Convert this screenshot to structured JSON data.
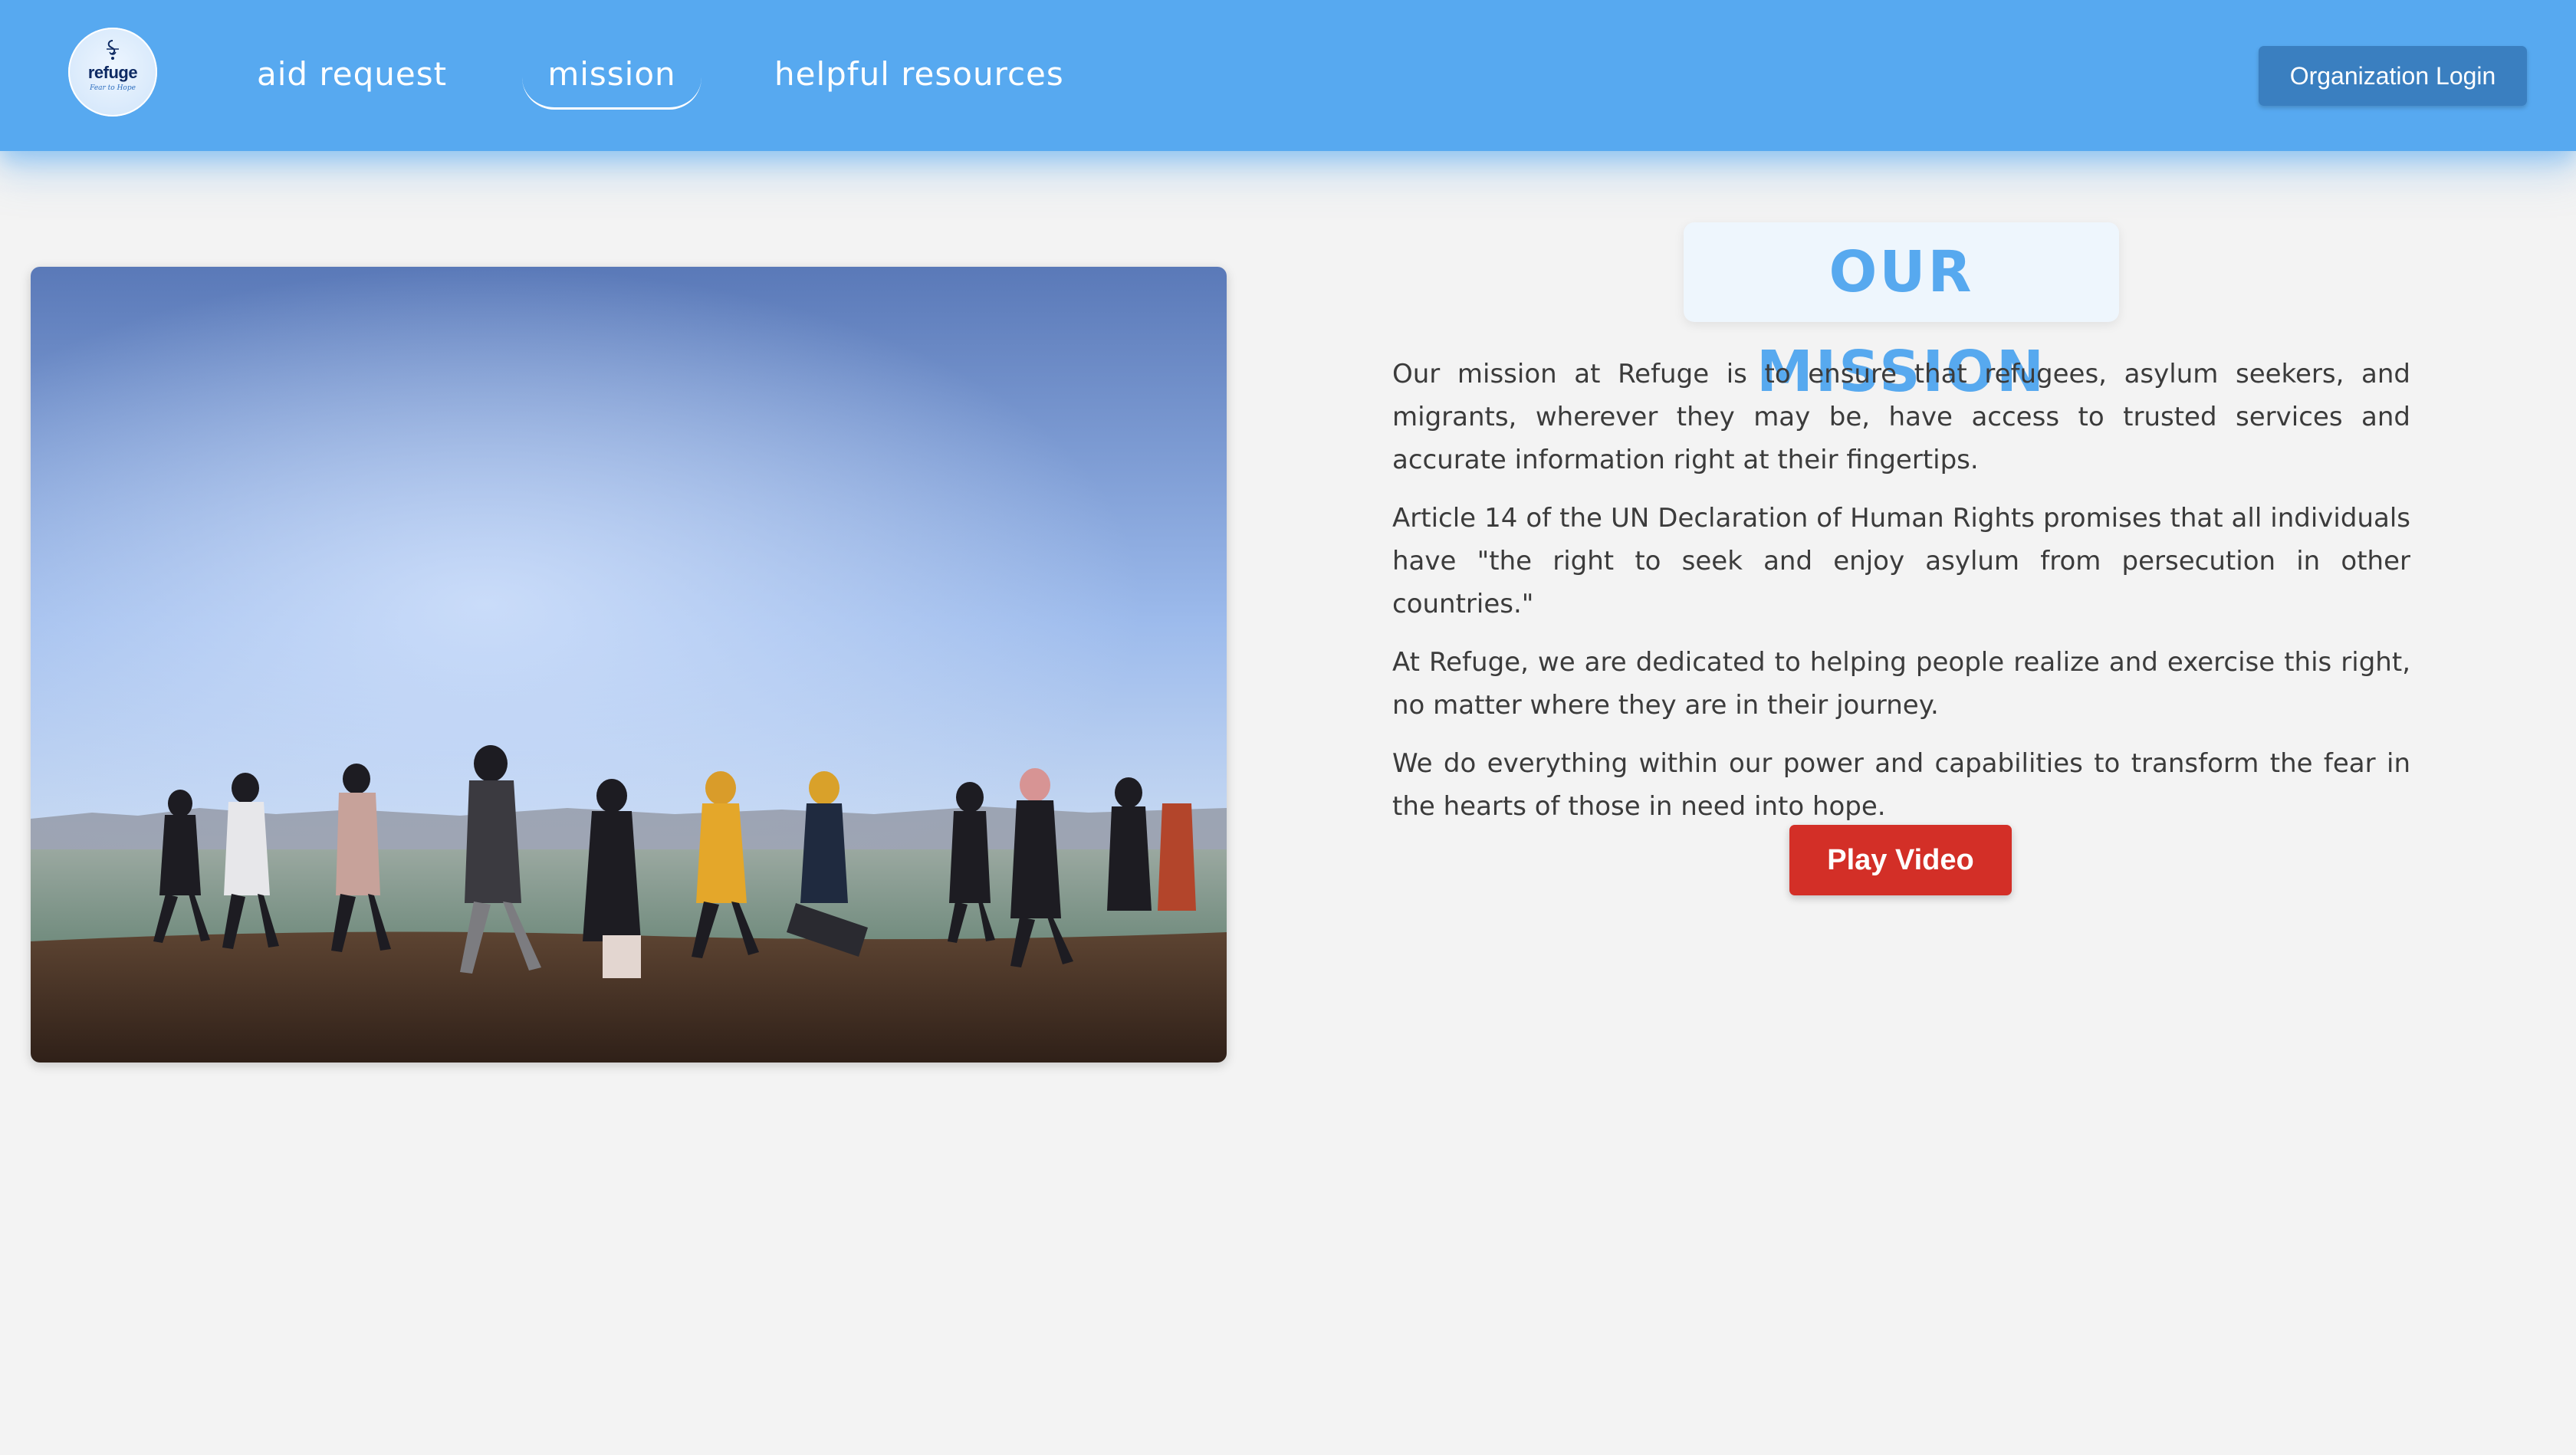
{
  "brand": {
    "logo_word": "refuge",
    "logo_tagline": "Fear to Hope",
    "logo_icon": "refuge-logo-icon"
  },
  "nav": {
    "links": [
      {
        "label": "aid request"
      },
      {
        "label": "mission",
        "active": true
      },
      {
        "label": "helpful resources"
      }
    ],
    "org_login_label": "Organization Login"
  },
  "mission": {
    "heading": "OUR MISSION",
    "paragraphs": [
      "Our mission at Refuge is to ensure that refugees, asylum seekers, and migrants, wherever they may be, have access to trusted services and accurate information right at their fingertips.",
      "Article 14 of the UN Declaration of Human Rights promises that all individuals have \"the right to seek and enjoy asylum from persecution in other countries.\"",
      "At Refuge, we are dedicated to helping people realize and exercise this right, no matter where they are in their journey.",
      "We do everything within our power and capabilities to transform the fear in the hearts of those in need into hope."
    ],
    "play_video_label": "Play Video"
  },
  "colors": {
    "header": "#57a9f0",
    "accent": "#57a9ef",
    "login_button": "#3a7fc0",
    "play_button": "#d32f27",
    "page_background": "#f3f3f3"
  }
}
